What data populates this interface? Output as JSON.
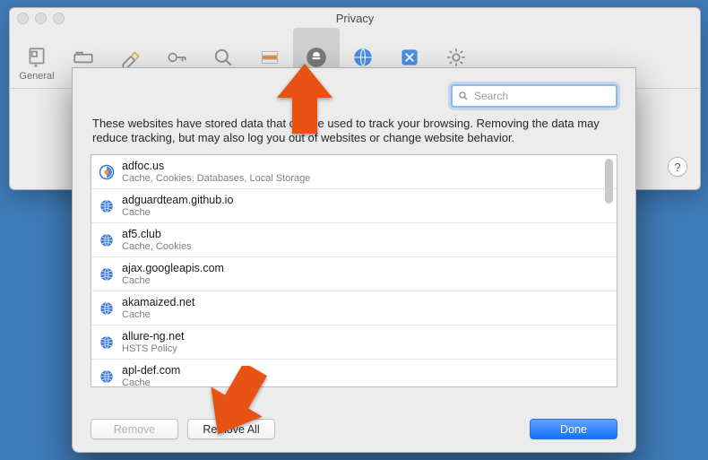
{
  "window": {
    "title": "Privacy"
  },
  "toolbar": {
    "items": [
      {
        "id": "general",
        "label": "General"
      },
      {
        "id": "tabs",
        "label": "Tabs"
      },
      {
        "id": "autofill",
        "label": "AutoFill"
      },
      {
        "id": "passwords",
        "label": "Passwords"
      },
      {
        "id": "search",
        "label": "Search"
      },
      {
        "id": "security",
        "label": "Security"
      },
      {
        "id": "privacy",
        "label": "Privacy",
        "selected": true
      },
      {
        "id": "websites",
        "label": "Websites"
      },
      {
        "id": "extensions",
        "label": "Extensions"
      },
      {
        "id": "advanced",
        "label": "Advanced"
      }
    ]
  },
  "help": {
    "label": "?"
  },
  "sheet": {
    "search": {
      "placeholder": "Search",
      "value": ""
    },
    "description": "These websites have stored data that can be used to track your browsing. Removing the data may reduce tracking, but may also log you out of websites or change website behavior.",
    "rows": [
      {
        "domain": "adfoc.us",
        "types": "Cache, Cookies, Databases, Local Storage",
        "favicon": "adfocus"
      },
      {
        "domain": "adguardteam.github.io",
        "types": "Cache",
        "favicon": "globe"
      },
      {
        "domain": "af5.club",
        "types": "Cache, Cookies",
        "favicon": "globe"
      },
      {
        "domain": "ajax.googleapis.com",
        "types": "Cache",
        "favicon": "globe"
      },
      {
        "domain": "akamaized.net",
        "types": "Cache",
        "favicon": "globe"
      },
      {
        "domain": "allure-ng.net",
        "types": "HSTS Policy",
        "favicon": "globe"
      },
      {
        "domain": "apl-def.com",
        "types": "Cache",
        "favicon": "globe"
      }
    ],
    "buttons": {
      "remove": "Remove",
      "remove_all": "Remove All",
      "done": "Done"
    }
  },
  "annotations": {
    "arrow_privacy": {
      "color": "#e85213"
    },
    "arrow_remove_all": {
      "color": "#e85213"
    }
  }
}
